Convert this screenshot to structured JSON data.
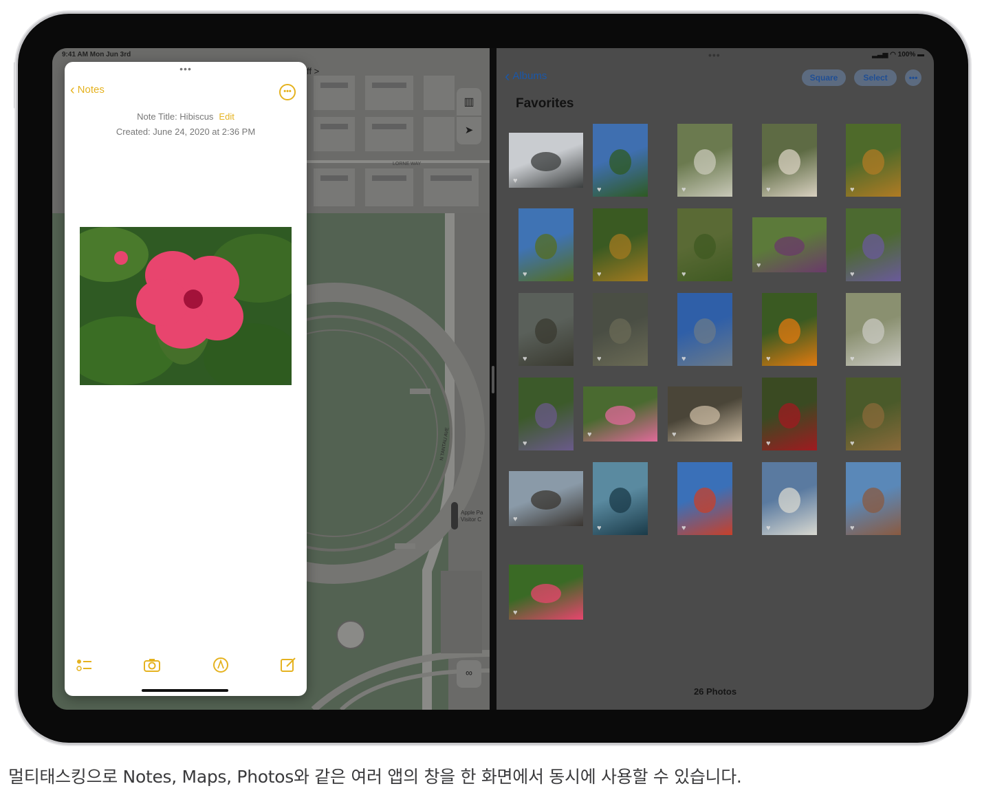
{
  "maps": {
    "status_time": "9:41 AM  Mon Jun 3rd",
    "street_label_1": "LORNE WAY",
    "street_label_2": "N TANTAU AVE",
    "poi_label": "Apple Pa\nVisitor C",
    "map_button_icon": "map-icon",
    "location_button_icon": "location-arrow-icon",
    "binoculars_icon": "binoculars-icon",
    "top_snip": "ff >"
  },
  "notes": {
    "back_label": "Notes",
    "note_title": "Note Title: Hibiscus",
    "edit_label": "Edit",
    "created": "Created: June 24, 2020 at 2:36 PM",
    "accent": "#e5b21f",
    "toolbar": [
      "checklist-icon",
      "camera-icon",
      "markup-icon",
      "compose-icon"
    ]
  },
  "photos": {
    "status_right": "100%",
    "back_label": "Albums",
    "square_label": "Square",
    "select_label": "Select",
    "title": "Favorites",
    "count": "26 Photos",
    "accent": "#1a57a8"
  },
  "caption": "멀티태스킹으로 Notes, Maps, Photos와 같은 여러 앱의 창을 한 화면에서 동시에 사용할 수 있습니다."
}
